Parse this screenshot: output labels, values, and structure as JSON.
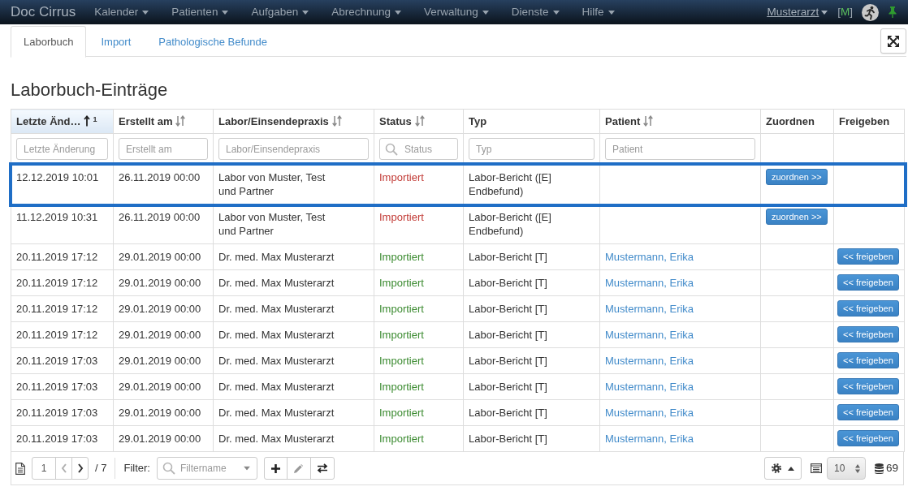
{
  "navbar": {
    "brand": "Doc Cirrus",
    "menus": [
      {
        "label": "Kalender"
      },
      {
        "label": "Patienten"
      },
      {
        "label": "Aufgaben"
      },
      {
        "label": "Abrechnung"
      },
      {
        "label": "Verwaltung"
      },
      {
        "label": "Dienste"
      },
      {
        "label": "Hilfe"
      }
    ],
    "user": "Musterarzt",
    "mode_indicator": {
      "prefix": "[",
      "label": "M",
      "suffix": "]"
    }
  },
  "tabs": [
    {
      "label": "Laborbuch",
      "selected": true
    },
    {
      "label": "Import",
      "selected": false
    },
    {
      "label": "Pathologische Befunde",
      "selected": false
    }
  ],
  "heading": "Laborbuch-Einträge",
  "table": {
    "columns": [
      {
        "label": "Letzte Änd…",
        "sortable": true,
        "sorted": true,
        "sort_rank": "1",
        "filter": {
          "placeholder": "Letzte Änderung"
        }
      },
      {
        "label": "Erstellt am",
        "sortable": true,
        "sorted": false,
        "filter": {
          "placeholder": "Erstellt am"
        }
      },
      {
        "label": "Labor/Einsendepraxis",
        "sortable": true,
        "sorted": false,
        "filter": {
          "placeholder": "Labor/Einsendepraxis"
        }
      },
      {
        "label": "Status",
        "sortable": true,
        "sorted": false,
        "filter": {
          "placeholder": "Status",
          "search_icon": true
        }
      },
      {
        "label": "Typ",
        "sortable": false,
        "sorted": false,
        "filter": {
          "placeholder": "Typ"
        }
      },
      {
        "label": "Patient",
        "sortable": true,
        "sorted": false,
        "filter": {
          "placeholder": "Patient"
        }
      },
      {
        "label": "Zuordnen",
        "sortable": false,
        "sorted": false
      },
      {
        "label": "Freigeben",
        "sortable": false,
        "sorted": false
      }
    ],
    "rows": [
      {
        "highlighted": true,
        "last_changed": "12.12.2019 10:01",
        "created": "26.11.2019 00:00",
        "lab": "Labor von Muster, Test und Partner",
        "status": {
          "label": "Importiert",
          "color": "#c23b36"
        },
        "type": "Labor-Bericht ([E] Endbefund)",
        "assign_button": "zuordnen >>"
      },
      {
        "highlighted": false,
        "last_changed": "11.12.2019 10:31",
        "created": "26.11.2019 00:00",
        "lab": "Labor von Muster, Test und Partner",
        "status": {
          "label": "Importiert",
          "color": "#c23b36"
        },
        "type": "Labor-Bericht ([E] Endbefund)",
        "assign_button": "zuordnen >>"
      },
      {
        "highlighted": false,
        "last_changed": "20.11.2019 17:12",
        "created": "29.01.2019 00:00",
        "lab": "Dr. med. Max Musterarzt",
        "status": {
          "label": "Importiert",
          "color": "#3a8a2f"
        },
        "type": "Labor-Bericht [T]",
        "patient": "Mustermann, Erika",
        "release_button": "<< freigeben"
      },
      {
        "highlighted": false,
        "last_changed": "20.11.2019 17:12",
        "created": "29.01.2019 00:00",
        "lab": "Dr. med. Max Musterarzt",
        "status": {
          "label": "Importiert",
          "color": "#3a8a2f"
        },
        "type": "Labor-Bericht [T]",
        "patient": "Mustermann, Erika",
        "release_button": "<< freigeben"
      },
      {
        "highlighted": false,
        "last_changed": "20.11.2019 17:12",
        "created": "29.01.2019 00:00",
        "lab": "Dr. med. Max Musterarzt",
        "status": {
          "label": "Importiert",
          "color": "#3a8a2f"
        },
        "type": "Labor-Bericht [T]",
        "patient": "Mustermann, Erika",
        "release_button": "<< freigeben"
      },
      {
        "highlighted": false,
        "last_changed": "20.11.2019 17:12",
        "created": "29.01.2019 00:00",
        "lab": "Dr. med. Max Musterarzt",
        "status": {
          "label": "Importiert",
          "color": "#3a8a2f"
        },
        "type": "Labor-Bericht [T]",
        "patient": "Mustermann, Erika",
        "release_button": "<< freigeben"
      },
      {
        "highlighted": false,
        "last_changed": "20.11.2019 17:03",
        "created": "29.01.2019 00:00",
        "lab": "Dr. med. Max Musterarzt",
        "status": {
          "label": "Importiert",
          "color": "#3a8a2f"
        },
        "type": "Labor-Bericht [T]",
        "patient": "Mustermann, Erika",
        "release_button": "<< freigeben"
      },
      {
        "highlighted": false,
        "last_changed": "20.11.2019 17:03",
        "created": "29.01.2019 00:00",
        "lab": "Dr. med. Max Musterarzt",
        "status": {
          "label": "Importiert",
          "color": "#3a8a2f"
        },
        "type": "Labor-Bericht [T]",
        "patient": "Mustermann, Erika",
        "release_button": "<< freigeben"
      },
      {
        "highlighted": false,
        "last_changed": "20.11.2019 17:03",
        "created": "29.01.2019 00:00",
        "lab": "Dr. med. Max Musterarzt",
        "status": {
          "label": "Importiert",
          "color": "#3a8a2f"
        },
        "type": "Labor-Bericht [T]",
        "patient": "Mustermann, Erika",
        "release_button": "<< freigeben"
      },
      {
        "highlighted": false,
        "last_changed": "20.11.2019 17:03",
        "created": "29.01.2019 00:00",
        "lab": "Dr. med. Max Musterarzt",
        "status": {
          "label": "Importiert",
          "color": "#3a8a2f"
        },
        "type": "Labor-Bericht [T]",
        "patient": "Mustermann, Erika",
        "release_button": "<< freigeben"
      }
    ]
  },
  "footer": {
    "pager": {
      "page": "1",
      "total": "/ 7",
      "prev": {
        "disabled": true
      },
      "next": {
        "disabled": false
      }
    },
    "filter": {
      "label": "Filter:",
      "placeholder": "Filtername"
    },
    "filter_actions": [
      {
        "kind": "add",
        "disabled": false
      },
      {
        "kind": "edit",
        "disabled": true
      },
      {
        "kind": "swap",
        "disabled": false
      }
    ],
    "page_size": "10",
    "record_count": "69"
  }
}
